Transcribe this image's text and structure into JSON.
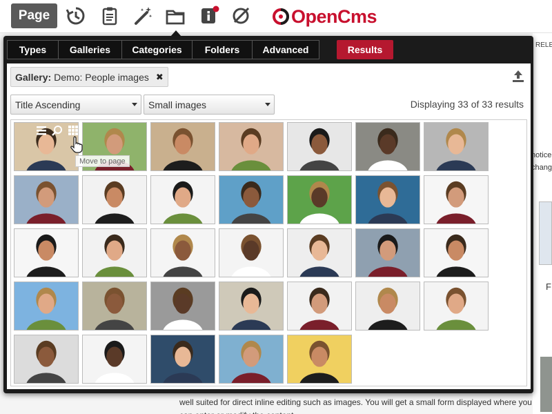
{
  "toolbar": {
    "page_label": "Page",
    "icons": [
      "history-icon",
      "clipboard-icon",
      "magic-wand-icon",
      "folder-icon",
      "info-icon",
      "hide-icon"
    ],
    "logo_text": "OpenCms"
  },
  "background": {
    "releases_text": "RELE",
    "notice_line1": "notice",
    "notice_line2": "chang",
    "f_text": "F",
    "bottom_text": "well suited for direct inline editing such as images. You will get a small form displayed where you can enter or modify the content."
  },
  "dialog": {
    "tabs": [
      "Types",
      "Galleries",
      "Categories",
      "Folders",
      "Advanced"
    ],
    "results_label": "Results",
    "gallery_prefix": "Gallery:",
    "gallery_name": "Demo: People images",
    "chip_close": "✖",
    "sort_value": "Title Ascending",
    "size_value": "Small images",
    "result_count": "Displaying 33 of 33 results",
    "tooltip": "Move to page",
    "colors": {
      "results": "#b5182f",
      "dialog_bg": "#1b1b1b",
      "accent": "#c8102e"
    }
  }
}
